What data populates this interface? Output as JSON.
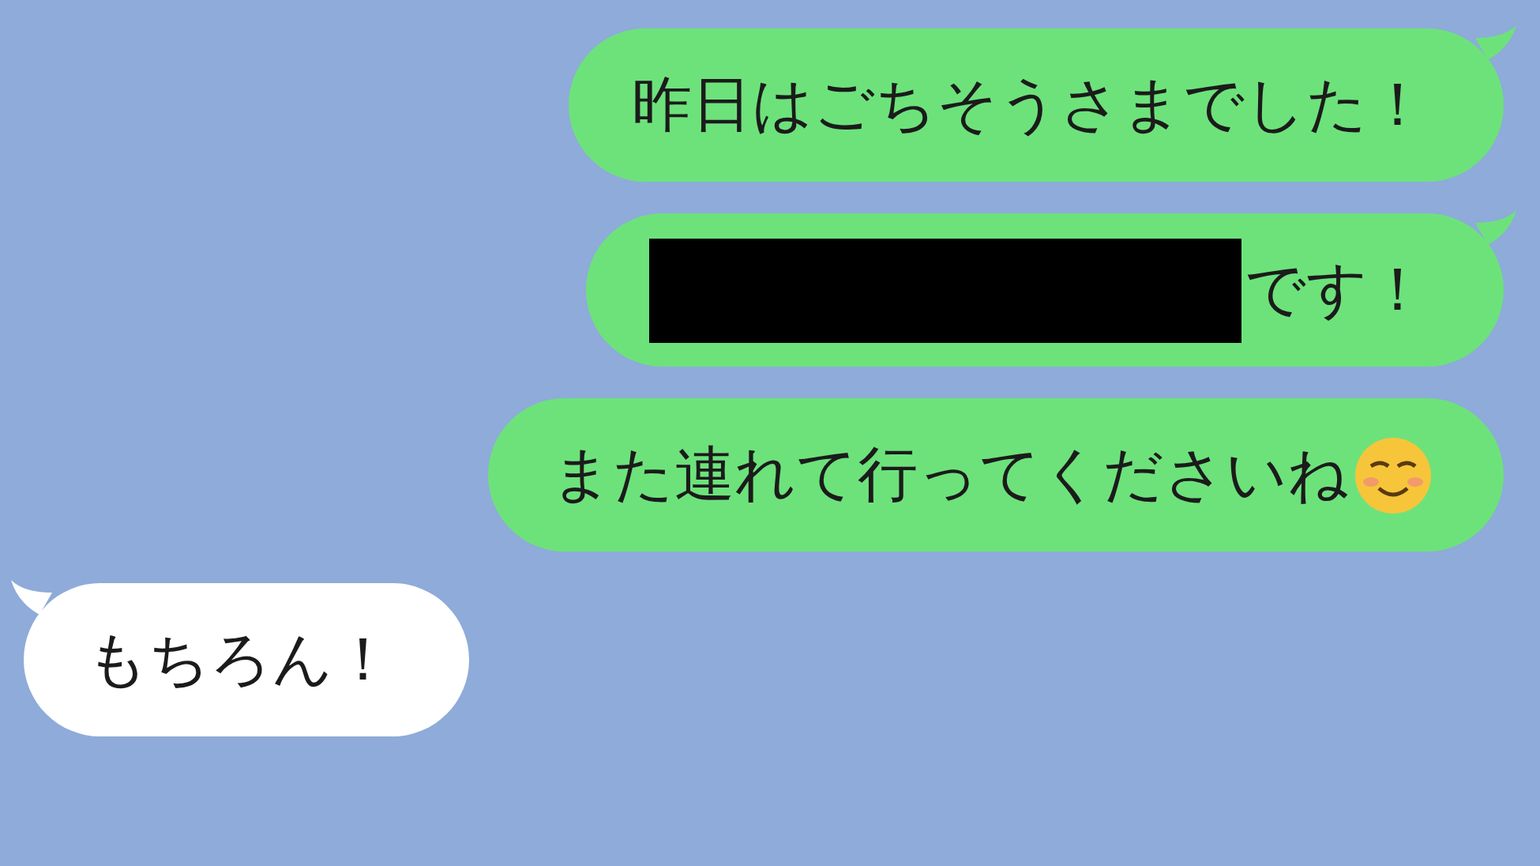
{
  "messages": [
    {
      "kind": "outgoing",
      "tail": true,
      "redacted": false,
      "text": "昨日はごちそうさまでした！",
      "has_emoji": false
    },
    {
      "kind": "outgoing",
      "tail": true,
      "redacted": true,
      "text": "です！",
      "has_emoji": false
    },
    {
      "kind": "outgoing",
      "tail": false,
      "redacted": false,
      "text": "また連れて行ってくださいね",
      "has_emoji": true
    },
    {
      "kind": "incoming",
      "tail": true,
      "redacted": false,
      "text": "もちろん！",
      "has_emoji": false
    }
  ]
}
